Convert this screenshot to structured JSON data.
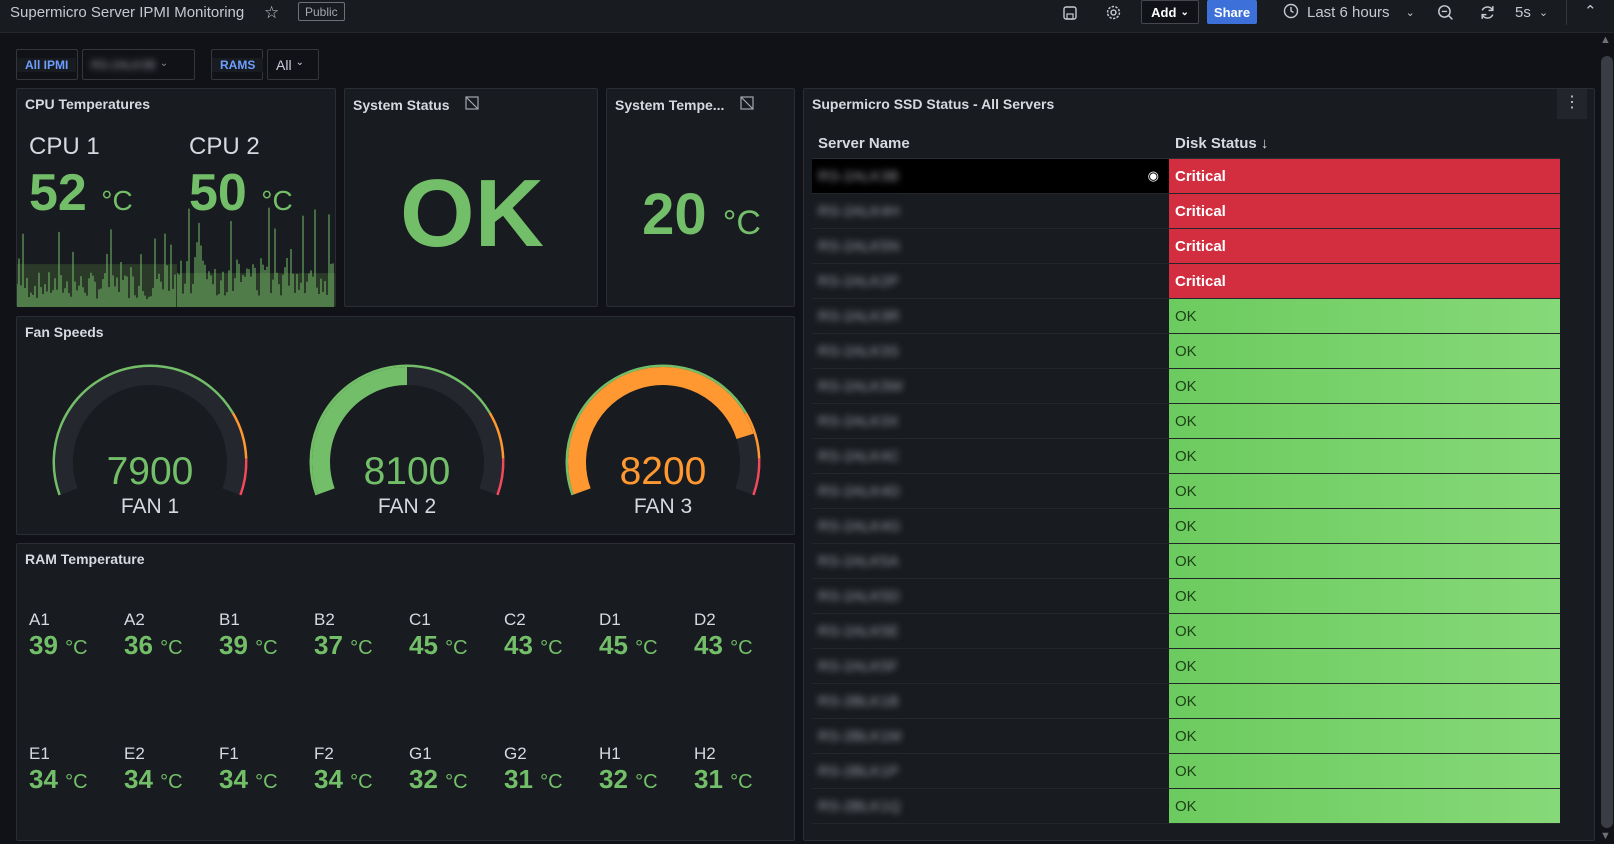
{
  "topbar": {
    "title": "Supermicro Server IPMI Monitoring",
    "public_badge": "Public",
    "add_label": "Add",
    "share_label": "Share",
    "time_range": "Last 6 hours",
    "refresh_interval": "5s"
  },
  "variables": [
    {
      "label": "All IPMI",
      "value": "RS-2ALK3B"
    },
    {
      "label": "RAMS",
      "value": "All"
    }
  ],
  "cpu_panel": {
    "title": "CPU Temperatures",
    "items": [
      {
        "name": "CPU 1",
        "value": "52",
        "unit": "°C"
      },
      {
        "name": "CPU 2",
        "value": "50",
        "unit": "°C"
      }
    ]
  },
  "status_panel": {
    "title": "System Status",
    "value": "OK"
  },
  "systemp_panel": {
    "title": "System Tempe...",
    "value": "20",
    "unit": "°C"
  },
  "fan_panel": {
    "title": "Fan Speeds",
    "fans": [
      {
        "name": "FAN 1",
        "value": "7900",
        "fill_fraction": 0.0,
        "color": "#73bf69"
      },
      {
        "name": "FAN 2",
        "value": "8100",
        "fill_fraction": 0.5,
        "color": "#73bf69"
      },
      {
        "name": "FAN 3",
        "value": "8200",
        "fill_fraction": 0.83,
        "color": "#ff9830"
      }
    ]
  },
  "ram_panel": {
    "title": "RAM Temperature",
    "unit": "°C",
    "row1": [
      {
        "name": "A1",
        "value": "39"
      },
      {
        "name": "A2",
        "value": "36"
      },
      {
        "name": "B1",
        "value": "39"
      },
      {
        "name": "B2",
        "value": "37"
      },
      {
        "name": "C1",
        "value": "45"
      },
      {
        "name": "C2",
        "value": "43"
      },
      {
        "name": "D1",
        "value": "45"
      },
      {
        "name": "D2",
        "value": "43"
      }
    ],
    "row2": [
      {
        "name": "E1",
        "value": "34"
      },
      {
        "name": "E2",
        "value": "34"
      },
      {
        "name": "F1",
        "value": "34"
      },
      {
        "name": "F2",
        "value": "34"
      },
      {
        "name": "G1",
        "value": "32"
      },
      {
        "name": "G2",
        "value": "31"
      },
      {
        "name": "H1",
        "value": "32"
      },
      {
        "name": "H2",
        "value": "31"
      }
    ]
  },
  "ssd_panel": {
    "title": "Supermicro SSD Status - All Servers",
    "columns": [
      "Server Name",
      "Disk Status"
    ],
    "rows": [
      {
        "server": "RS-2ALK3B",
        "status": "Critical"
      },
      {
        "server": "RS-2ALK4H",
        "status": "Critical"
      },
      {
        "server": "RS-2ALK5N",
        "status": "Critical"
      },
      {
        "server": "RS-2ALK2P",
        "status": "Critical"
      },
      {
        "server": "RS-2ALK3R",
        "status": "OK"
      },
      {
        "server": "RS-2ALK3S",
        "status": "OK"
      },
      {
        "server": "RS-2ALK3W",
        "status": "OK"
      },
      {
        "server": "RS-2ALK3X",
        "status": "OK"
      },
      {
        "server": "RS-2ALK4C",
        "status": "OK"
      },
      {
        "server": "RS-2ALK4D",
        "status": "OK"
      },
      {
        "server": "RS-2ALK4G",
        "status": "OK"
      },
      {
        "server": "RS-2ALK5A",
        "status": "OK"
      },
      {
        "server": "RS-2ALK5D",
        "status": "OK"
      },
      {
        "server": "RS-2ALK5E",
        "status": "OK"
      },
      {
        "server": "RS-2ALK5F",
        "status": "OK"
      },
      {
        "server": "RS-2BLK1B",
        "status": "OK"
      },
      {
        "server": "RS-2BLK1M",
        "status": "OK"
      },
      {
        "server": "RS-2BLK1P",
        "status": "OK"
      },
      {
        "server": "RS-2BLK1Q",
        "status": "OK"
      }
    ]
  }
}
